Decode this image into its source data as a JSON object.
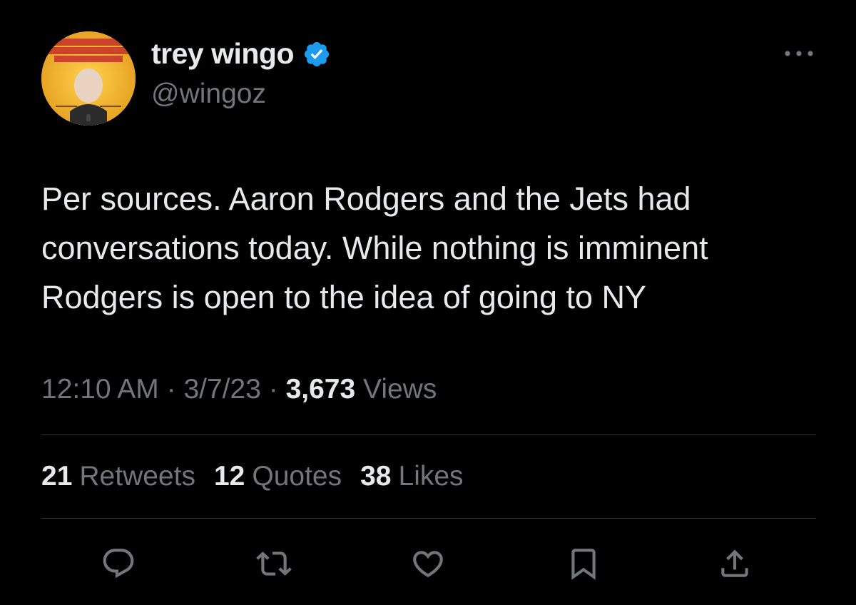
{
  "author": {
    "display_name": "trey wingo",
    "handle": "@wingoz",
    "avatar_icon": "profile-avatar",
    "verified_icon": "verified-badge-icon",
    "verified_color": "#1d9bf0"
  },
  "tweet": {
    "text_lines": [
      "Per sources. Aaron Rodgers and the Jets had",
      "conversations today. While nothing is imminent",
      "Rodgers is open to the idea of going to NY"
    ]
  },
  "meta": {
    "time": "12:10 AM",
    "sep1": " · ",
    "date": "3/7/23",
    "sep2": " · ",
    "views_count": "3,673",
    "views_label": "Views"
  },
  "stats": {
    "retweets_count": "21",
    "retweets_label": "Retweets",
    "quotes_count": "12",
    "quotes_label": "Quotes",
    "likes_count": "38",
    "likes_label": "Likes"
  },
  "actions": {
    "reply_icon": "reply-icon",
    "retweet_icon": "retweet-icon",
    "like_icon": "heart-icon",
    "bookmark_icon": "bookmark-icon",
    "share_icon": "share-icon"
  },
  "colors": {
    "background": "#000000",
    "primary_text": "#e7e9ea",
    "secondary_text": "#71767b",
    "divider": "#2f3336",
    "accent": "#1d9bf0"
  }
}
